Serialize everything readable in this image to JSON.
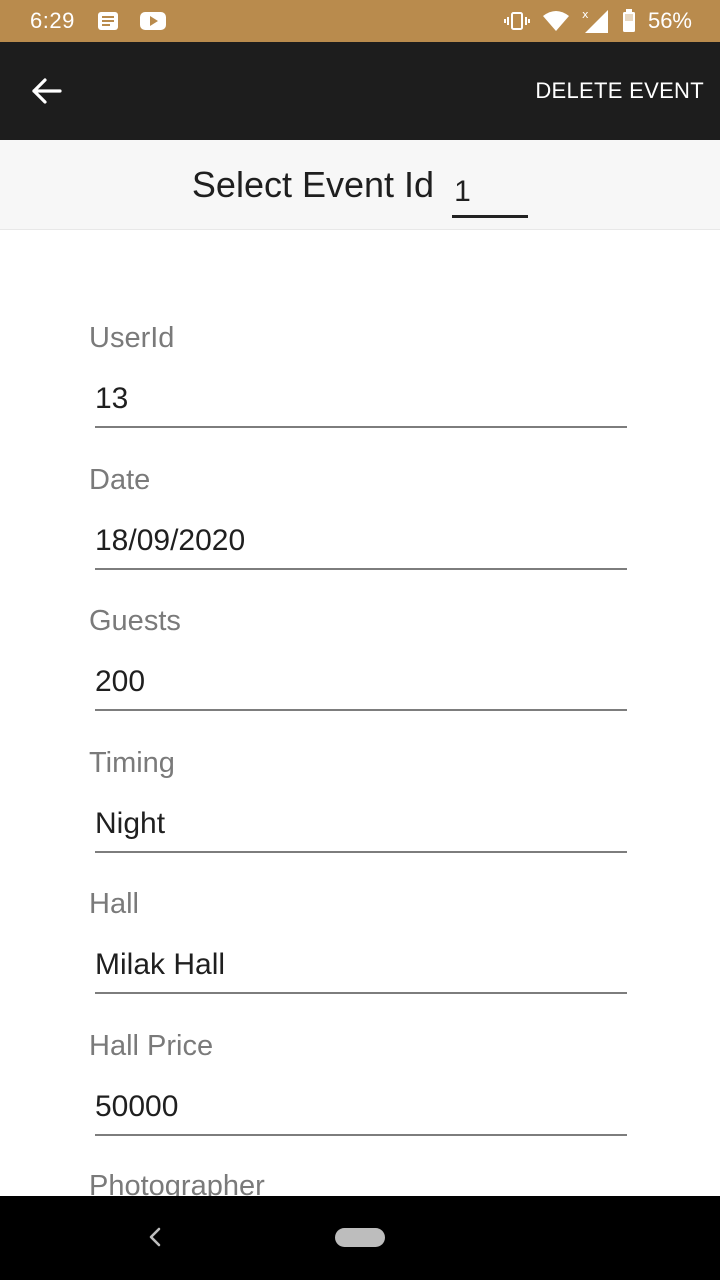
{
  "status_bar": {
    "time": "6:29",
    "battery_percent": "56%",
    "icons": [
      "messages-icon",
      "youtube-icon",
      "vibrate-icon",
      "wifi-icon",
      "signal-icon",
      "battery-icon"
    ]
  },
  "app_bar": {
    "back_icon": "arrow-back-icon",
    "delete_label": "DELETE EVENT"
  },
  "event_selector": {
    "label": "Select Event Id",
    "value": "1"
  },
  "fields": [
    {
      "label": "UserId",
      "value": "13"
    },
    {
      "label": "Date",
      "value": "18/09/2020"
    },
    {
      "label": "Guests",
      "value": "200"
    },
    {
      "label": "Timing",
      "value": "Night"
    },
    {
      "label": "Hall",
      "value": "Milak Hall"
    },
    {
      "label": "Hall Price",
      "value": "50000"
    },
    {
      "label": "Photographer",
      "value": ""
    }
  ],
  "nav_bar": {
    "back_icon": "nav-back-icon",
    "home_icon": "nav-home-pill"
  },
  "colors": {
    "status_bar": "#b98b4d",
    "app_bar": "#1d1d1d",
    "label": "#7a7a7a",
    "value": "#1f1f1f",
    "underline": "#7d7d7d"
  }
}
